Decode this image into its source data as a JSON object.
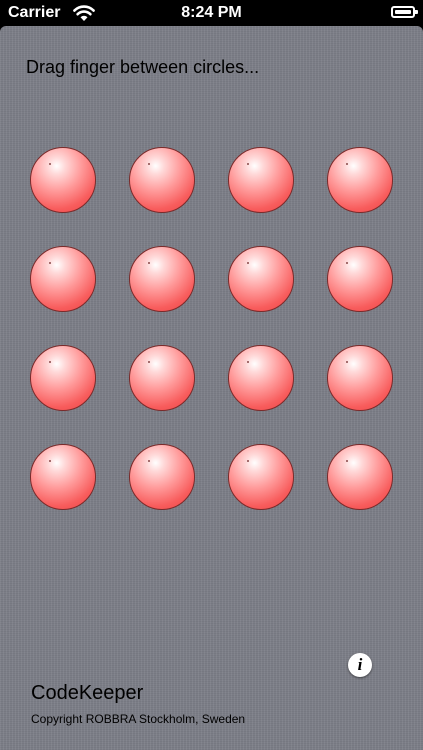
{
  "status_bar": {
    "carrier": "Carrier",
    "time": "8:24 PM",
    "wifi_icon": "wifi-icon",
    "battery_icon": "battery-icon"
  },
  "main": {
    "instruction": "Drag finger between circles...",
    "circle_color": "#f85c5c",
    "circles": [
      {
        "row": 1,
        "col": 1
      },
      {
        "row": 1,
        "col": 2
      },
      {
        "row": 1,
        "col": 3
      },
      {
        "row": 1,
        "col": 4
      },
      {
        "row": 2,
        "col": 1
      },
      {
        "row": 2,
        "col": 2
      },
      {
        "row": 2,
        "col": 3
      },
      {
        "row": 2,
        "col": 4
      },
      {
        "row": 3,
        "col": 1
      },
      {
        "row": 3,
        "col": 2
      },
      {
        "row": 3,
        "col": 3
      },
      {
        "row": 3,
        "col": 4
      },
      {
        "row": 4,
        "col": 1
      },
      {
        "row": 4,
        "col": 2
      },
      {
        "row": 4,
        "col": 3
      },
      {
        "row": 4,
        "col": 4
      }
    ]
  },
  "footer": {
    "app_name": "CodeKeeper",
    "copyright": "Copyright ROBBRA Stockholm, Sweden",
    "info_label": "i",
    "info_icon": "info-icon"
  }
}
